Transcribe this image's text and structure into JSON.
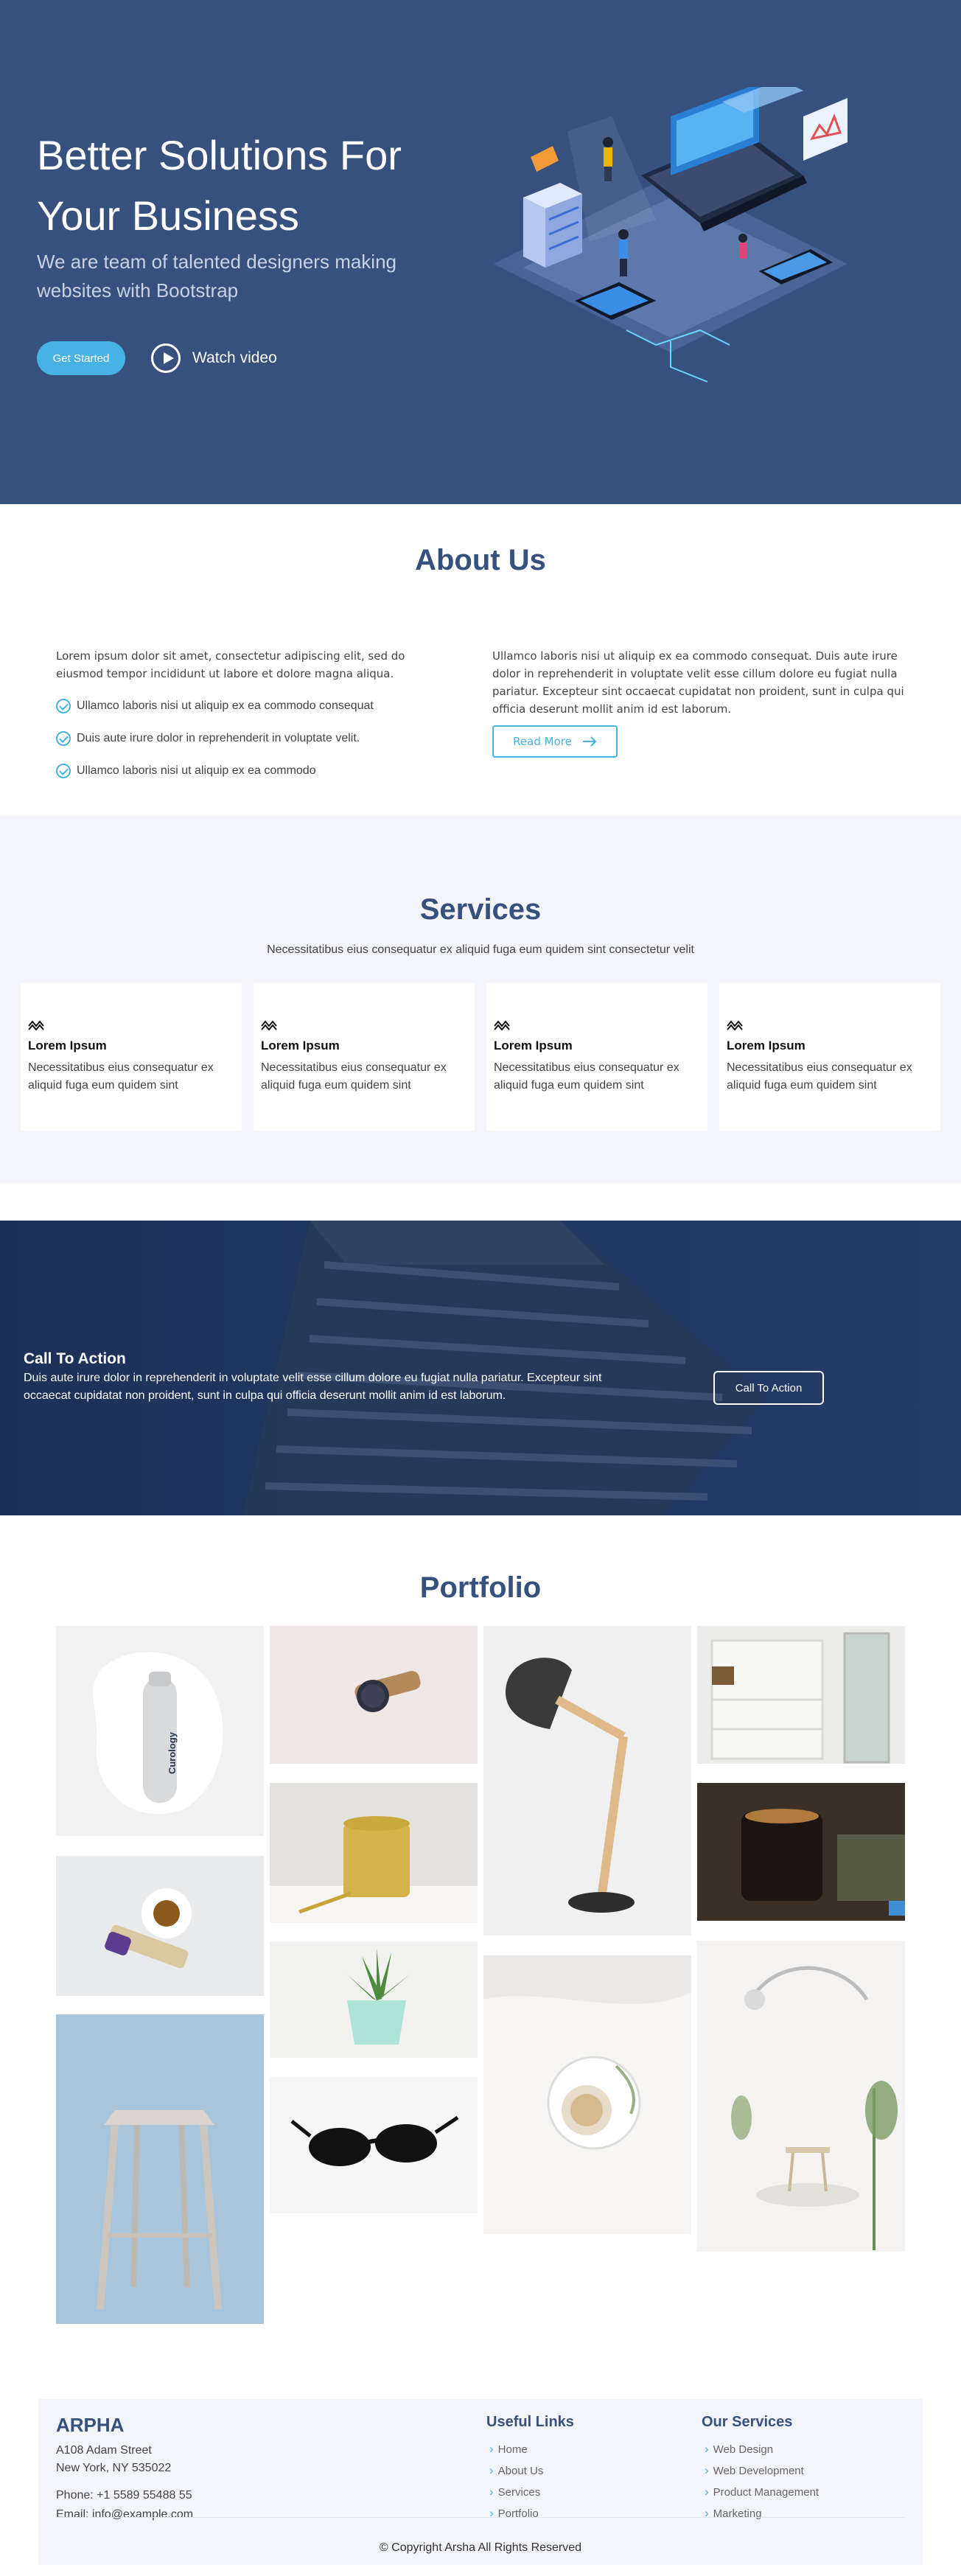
{
  "hero": {
    "title_line1": "Better Solutions For",
    "title_line2": "Your Business",
    "subtitle_line1": "We are team of talented designers making",
    "subtitle_line2": "websites with Bootstrap",
    "get_started": "Get Started",
    "watch_video": "Watch video"
  },
  "about": {
    "title": "About Us",
    "intro": "Lorem ipsum dolor sit amet, consectetur adipiscing elit, sed do eiusmod tempor incididunt ut labore et dolore magna aliqua.",
    "items": [
      "Ullamco laboris nisi ut aliquip ex ea commodo consequat",
      "Duis aute irure dolor in reprehenderit in voluptate velit.",
      "Ullamco laboris nisi ut aliquip ex ea commodo"
    ],
    "right_text": "Ullamco laboris nisi ut aliquip ex ea commodo consequat. Duis aute irure dolor in reprehenderit in voluptate velit esse cillum dolore eu fugiat nulla pariatur. Excepteur sint occaecat cupidatat non proident, sunt in culpa qui officia deserunt mollit anim id est laborum.",
    "read_more": "Read More"
  },
  "services": {
    "title": "Services",
    "description": "Necessitatibus eius consequatur ex aliquid fuga eum quidem sint consectetur velit",
    "cards": [
      {
        "title": "Lorem Ipsum",
        "text": "Necessitatibus eius consequatur ex aliquid fuga eum quidem sint"
      },
      {
        "title": "Lorem Ipsum",
        "text": "Necessitatibus eius consequatur ex aliquid fuga eum quidem sint"
      },
      {
        "title": "Lorem Ipsum",
        "text": "Necessitatibus eius consequatur ex aliquid fuga eum quidem sint"
      },
      {
        "title": "Lorem Ipsum",
        "text": "Necessitatibus eius consequatur ex aliquid fuga eum quidem sint"
      }
    ]
  },
  "cta": {
    "title": "Call To Action",
    "text": "Duis aute irure dolor in reprehenderit in voluptate velit esse cillum dolore eu fugiat nulla pariatur. Excepteur sint occaecat cupidatat non proident, sunt in culpa qui officia deserunt mollit anim id est laborum.",
    "button": "Call To Action"
  },
  "portfolio": {
    "title": "Portfolio",
    "bottle_brand": "Curology"
  },
  "footer": {
    "brand": "ARPHA",
    "address_line1": "A108 Adam Street",
    "address_line2": "New York, NY 535022",
    "phone": "Phone: +1 5589 55488 55",
    "email": "Email: info@example.com",
    "useful_links_title": "Useful Links",
    "useful_links": [
      "Home",
      "About Us",
      "Services",
      "Portfolio"
    ],
    "services_title": "Our Services",
    "services_links": [
      "Web Design",
      "Web Development",
      "Product Management",
      "Marketing"
    ],
    "copyright": "© Copyright Arsha All Rights Reserved"
  },
  "colors": {
    "primary": "#37517e",
    "accent": "#47b2e4",
    "section_bg": "#f3f5fa"
  }
}
